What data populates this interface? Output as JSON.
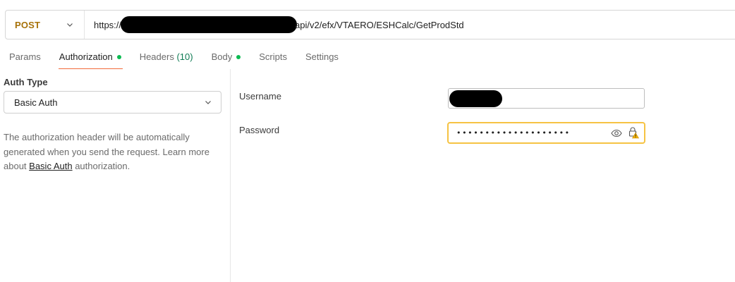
{
  "request": {
    "method": "POST",
    "url_prefix": "https://",
    "url_suffix": "api/v2/efx/VTAERO/ESHCalc/GetProdStd"
  },
  "tabs": [
    {
      "label": "Params"
    },
    {
      "label": "Authorization",
      "dot": true,
      "active": true
    },
    {
      "label": "Headers",
      "count": "(10)"
    },
    {
      "label": "Body",
      "dot": true
    },
    {
      "label": "Scripts"
    },
    {
      "label": "Settings"
    }
  ],
  "auth": {
    "type_label": "Auth Type",
    "selected": "Basic Auth",
    "desc_part1": "The authorization header will be automatically generated when you send the request. Learn more about ",
    "desc_link": "Basic Auth",
    "desc_part2": " authorization."
  },
  "form": {
    "username_label": "Username",
    "password_label": "Password",
    "password_value": "••••••••••••••••••••"
  },
  "colors": {
    "method": "#a7720a",
    "active_tab_underline": "#f26b3a",
    "status_dot": "#0cbb52",
    "warning_border": "#f6c343"
  },
  "icons": [
    "chevron-down-icon",
    "eye-icon",
    "lock-warning-icon"
  ]
}
